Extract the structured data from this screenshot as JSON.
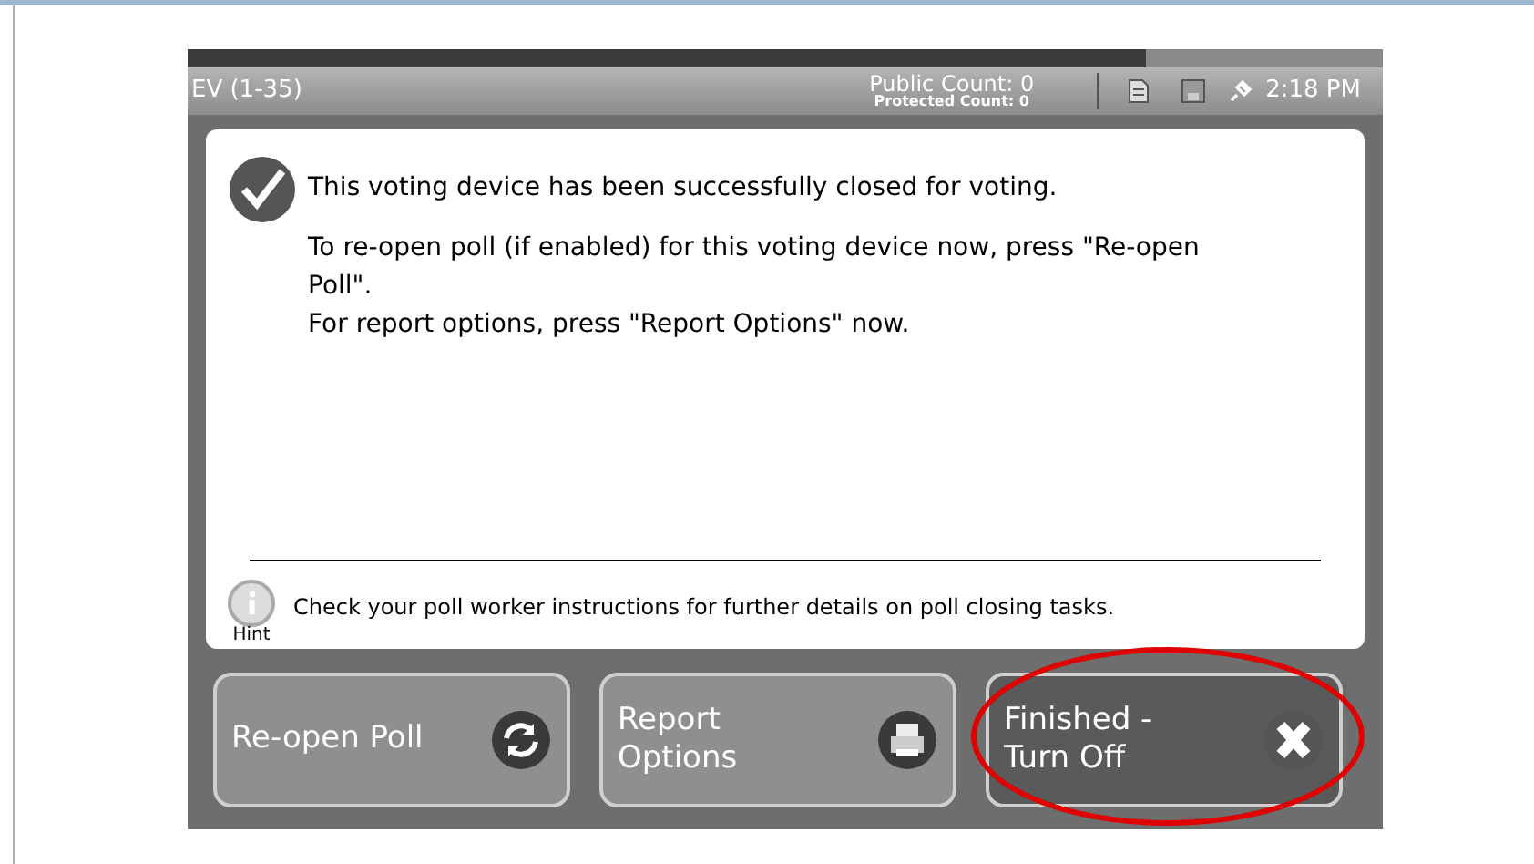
{
  "status_bar": {
    "station": "EV (1-35)",
    "public_count": "Public Count: 0",
    "protected_count": "Protected Count: 0",
    "time": "2:18 PM"
  },
  "message": {
    "headline": "This voting device has been successfully closed for voting.",
    "lines": [
      "To re-open poll (if enabled) for this voting device now, press \"Re-open Poll\".",
      "For report options, press \"Report Options\" now."
    ]
  },
  "hint": {
    "label": "Hint",
    "text": "Check your poll worker instructions for further details on poll closing tasks."
  },
  "buttons": [
    {
      "label": "Re-open Poll",
      "kind": "reopen",
      "highlighted": false
    },
    {
      "label": "Report\nOptions",
      "kind": "report",
      "highlighted": false
    },
    {
      "label": "Finished -\nTurn Off",
      "kind": "finish",
      "highlighted": true
    }
  ]
}
